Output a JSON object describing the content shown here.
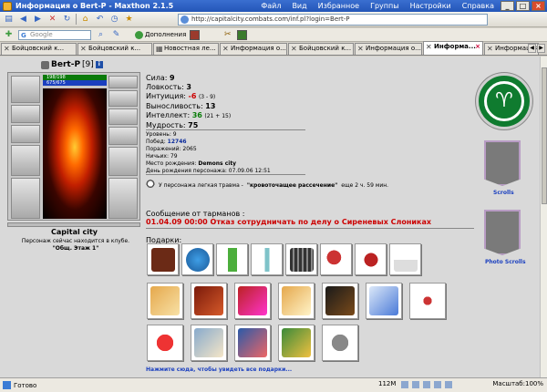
{
  "window": {
    "title": "Информация о Bert-P - Maxthon 2.1.5",
    "menu": [
      "Файл",
      "Вид",
      "Избранное",
      "Группы",
      "Настройки",
      "Справка"
    ]
  },
  "address": {
    "url": "http://capitalcity.combats.com/inf.pl?login=Bert-P"
  },
  "search": {
    "placeholder": "Google",
    "addons_label": "Дополнения"
  },
  "tabs": [
    {
      "label": "Бойцовский к..."
    },
    {
      "label": "Бойцовский к..."
    },
    {
      "label": "Новостная ле..."
    },
    {
      "label": "Информация о..."
    },
    {
      "label": "Бойцовский к..."
    },
    {
      "label": "Информация о..."
    },
    {
      "label": "Информа..."
    },
    {
      "label": "Информация о..."
    }
  ],
  "character": {
    "name": "Bert-P",
    "level": "[9]",
    "info_badge": "i",
    "hp": "198/198",
    "mp": "675/675",
    "city": "Capital city",
    "location_note": "Персонаж сейчас находится в клубе.",
    "location_place": "\"Общ. Этаж 1\""
  },
  "stats": {
    "strength_label": "Сила:",
    "strength": "9",
    "agility_label": "Ловкость:",
    "agility": "3",
    "intuition_label": "Интуиция:",
    "intuition": "-6",
    "intuition_extra": "(3 - 9)",
    "endurance_label": "Выносливость:",
    "endurance": "13",
    "intellect_label": "Интеллект:",
    "intellect": "36",
    "intellect_extra": "(21 + 15)",
    "wisdom_label": "Мудрость:",
    "wisdom": "75"
  },
  "info": {
    "level_line": "Уровень: 9",
    "wins_label": "Побед:",
    "wins": "12746",
    "losses_line": "Поражений: 2065",
    "draws_line": "Ничьих: 79",
    "birthplace_label": "Место рождения:",
    "birthplace": "Demons city",
    "birthday_line": "День рождения персонажа: 07.09.06 12:51"
  },
  "injury": {
    "prefix": "У персонажа легкая травма -",
    "name": "\"кровоточащее рассечение\"",
    "suffix": "еще 2 ч. 59 мин."
  },
  "message": {
    "title": "Сообщение от тарманов :",
    "text": "01.04.09 00:00 Отказ сотрудничать по делу о Сиреневых Слониках"
  },
  "gifts": {
    "title": "Подарки:",
    "more_link": "Нажмите сюда, чтобы увидеть все подарки..."
  },
  "right": {
    "scrolls_label": "Scrolls",
    "photo_scrolls_label": "Photo Scrolls"
  },
  "status": {
    "text": "Готово",
    "memory": "112M",
    "zoom": "Масштаб:100%"
  }
}
